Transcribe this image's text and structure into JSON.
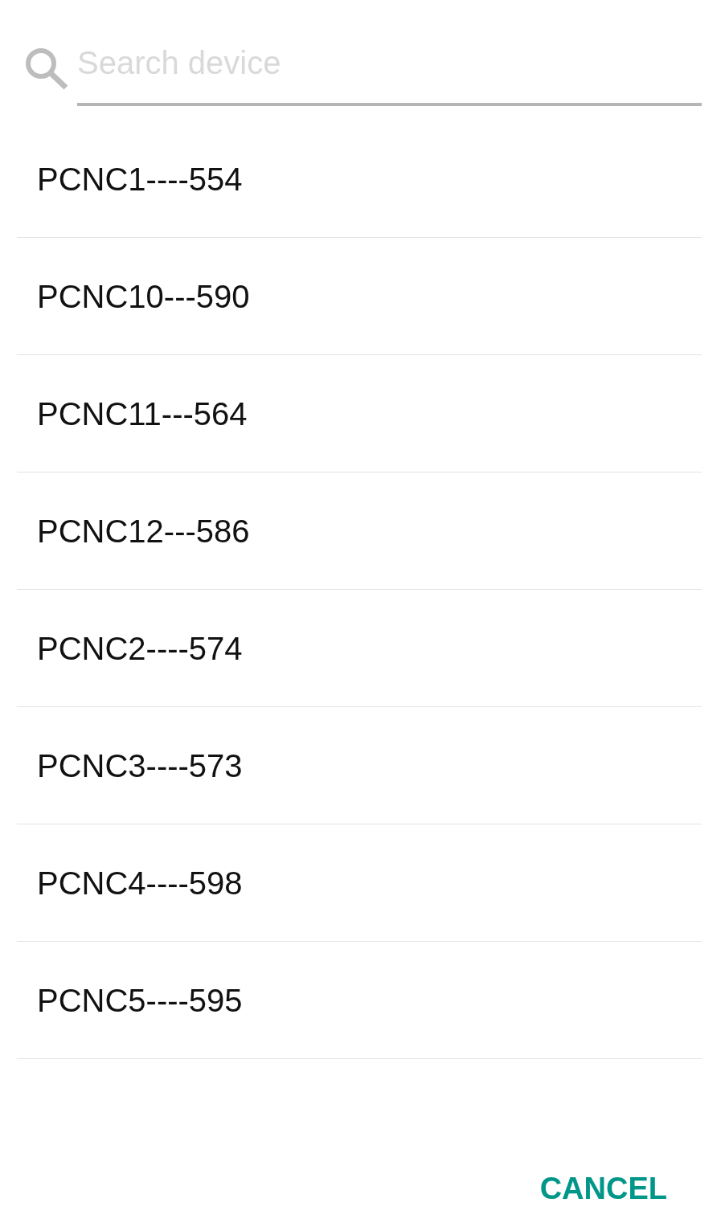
{
  "search": {
    "placeholder": "Search device"
  },
  "devices": [
    "PCNC1----554",
    "PCNC10---590",
    "PCNC11---564",
    "PCNC12---586",
    "PCNC2----574",
    "PCNC3----573",
    "PCNC4----598",
    "PCNC5----595"
  ],
  "cancel_button": {
    "label": "CANCEL"
  }
}
